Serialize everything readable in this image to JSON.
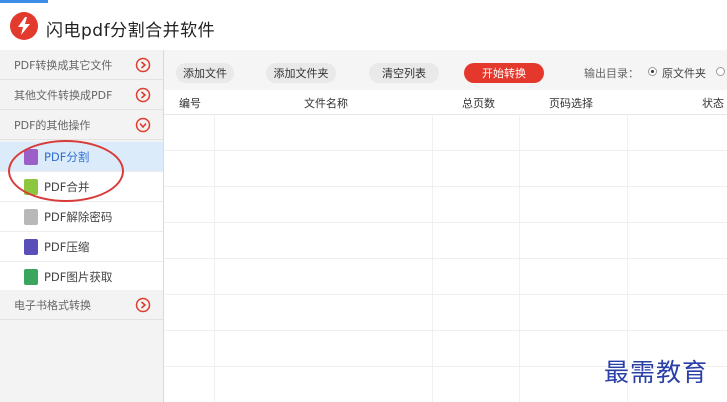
{
  "app": {
    "title": "闪电pdf分割合并软件"
  },
  "sidebar": {
    "categories": [
      {
        "label": "PDF转换成其它文件",
        "icon": "chevron-right-circle-icon"
      },
      {
        "label": "其他文件转换成PDF",
        "icon": "chevron-right-circle-icon"
      },
      {
        "label": "PDF的其他操作",
        "icon": "chevron-down-circle-icon"
      },
      {
        "label": "电子书格式转换",
        "icon": "chevron-right-circle-icon"
      }
    ],
    "items": [
      {
        "label": "PDF分割",
        "icon": "split-icon",
        "color": "#9b5fc7",
        "active": true
      },
      {
        "label": "PDF合并",
        "icon": "merge-icon",
        "color": "#8dc63f"
      },
      {
        "label": "PDF解除密码",
        "icon": "unlock-icon",
        "color": "#b8b8b8"
      },
      {
        "label": "PDF压缩",
        "icon": "compress-icon",
        "color": "#5a4fb8"
      },
      {
        "label": "PDF图片获取",
        "icon": "image-extract-icon",
        "color": "#3aa55d"
      }
    ]
  },
  "toolbar": {
    "add_file": "添加文件",
    "add_folder": "添加文件夹",
    "clear_list": "清空列表",
    "start": "开始转换",
    "output_dir_label": "输出目录：",
    "output_option": "原文件夹"
  },
  "table": {
    "columns": [
      "编号",
      "文件名称",
      "总页数",
      "页码选择",
      "状态"
    ]
  },
  "watermark": "最需教育",
  "colors": {
    "accent": "#e5382c",
    "active_bg": "#dcebf9",
    "annotation": "#d93a3a"
  }
}
